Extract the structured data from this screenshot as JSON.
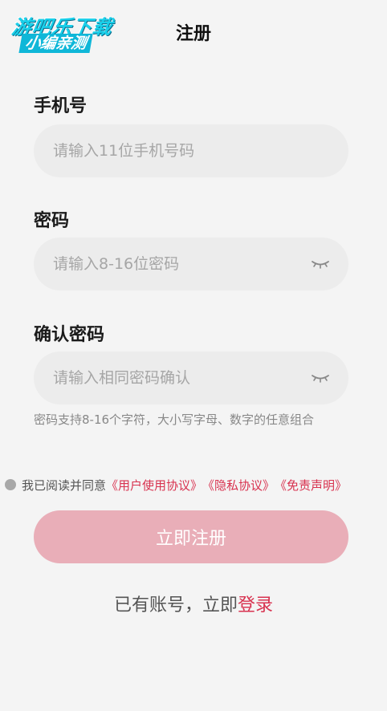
{
  "header": {
    "title": "注册",
    "watermark_line1": "游吧乐下载",
    "watermark_line2": "小编亲测"
  },
  "phone": {
    "label": "手机号",
    "placeholder": "请输入11位手机号码"
  },
  "password": {
    "label": "密码",
    "placeholder": "请输入8-16位密码"
  },
  "confirm": {
    "label": "确认密码",
    "placeholder": "请输入相同密码确认"
  },
  "hint": "密码支持8-16个字符，大小写字母、数字的任意组合",
  "agreement": {
    "prefix": "我已阅读并同意",
    "user_agreement": "《用户使用协议》",
    "privacy": "《隐私协议》",
    "disclaimer": "《免责声明》"
  },
  "submit_label": "立即注册",
  "login": {
    "prefix": "已有账号，立即",
    "link": "登录"
  },
  "colors": {
    "accent": "#d8324f",
    "button_bg": "#e9aeb8",
    "input_bg": "#ececec",
    "page_bg": "#f4f4f4"
  },
  "icons": {
    "back": "chevron-left-icon",
    "password_toggle": "eye-closed-icon"
  }
}
